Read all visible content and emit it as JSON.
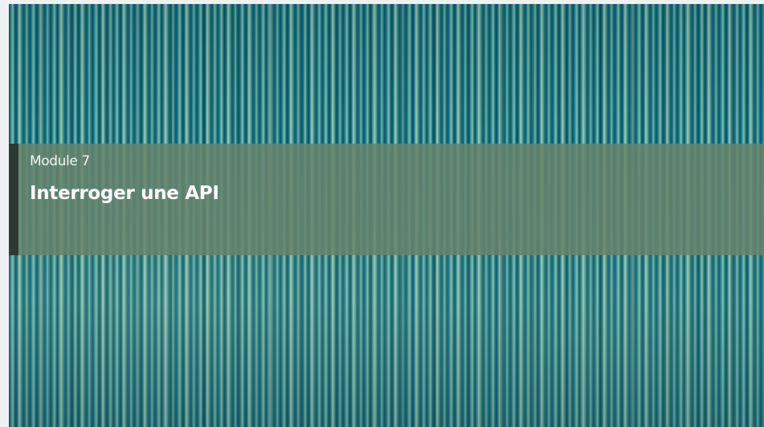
{
  "slide": {
    "module_label": "Module 7",
    "title": "Interroger une API",
    "colors": {
      "band": "#66846c",
      "accent_bar": "#2c3a33",
      "text": "#ffffff",
      "background_teal": "#18778b"
    }
  }
}
